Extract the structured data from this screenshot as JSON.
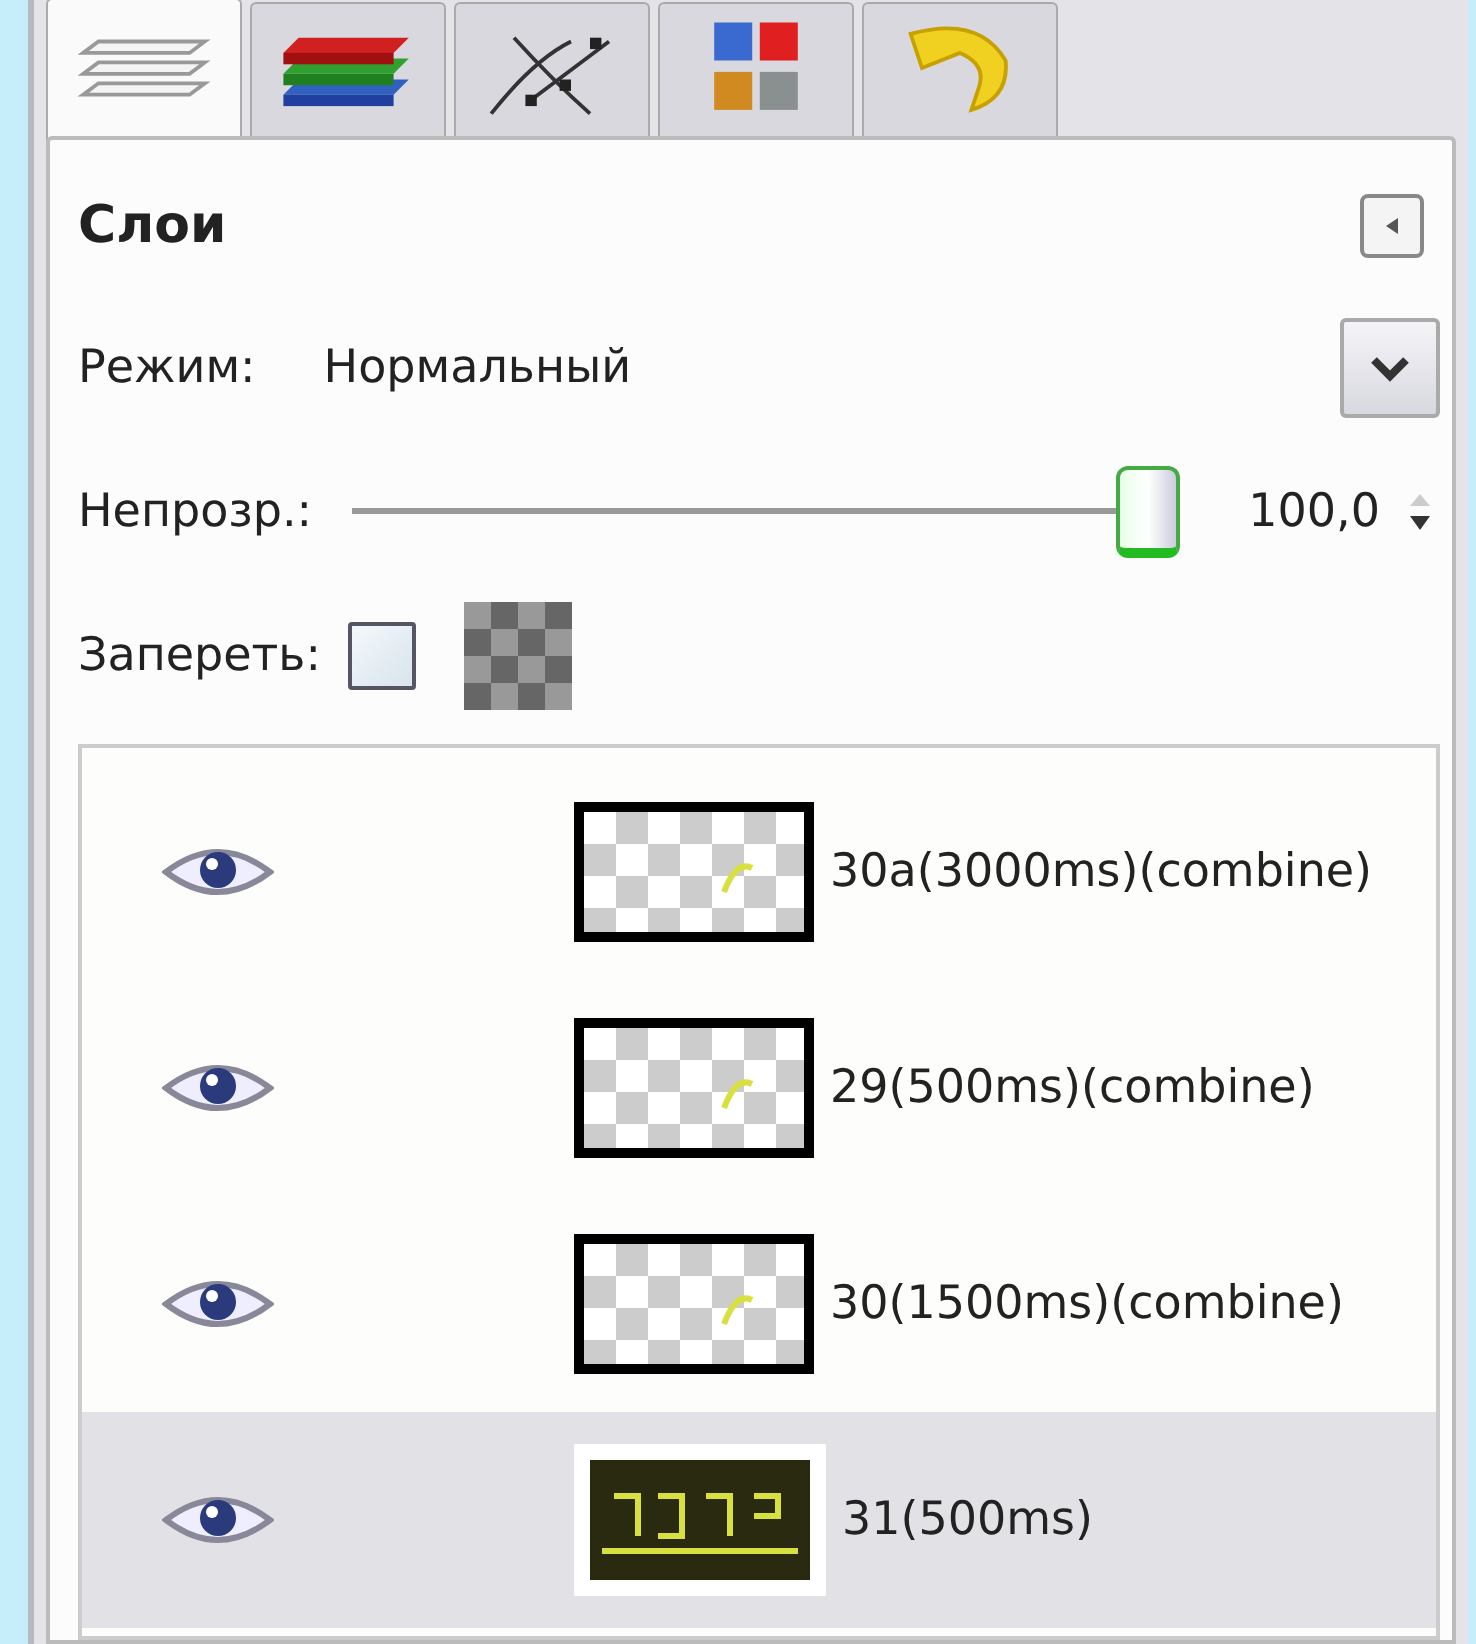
{
  "tabs": [
    {
      "kind": "layers",
      "selected": true
    },
    {
      "kind": "channels",
      "selected": false
    },
    {
      "kind": "paths",
      "selected": false
    },
    {
      "kind": "colors",
      "selected": false
    },
    {
      "kind": "undo",
      "selected": false
    }
  ],
  "title": "Слои",
  "mode": {
    "label": "Режим:",
    "value": "Нормальный"
  },
  "opacity": {
    "label": "Непрозр.:",
    "level": 1,
    "reading": "100,0"
  },
  "lock": {
    "label": "Запереть:",
    "checked": false
  },
  "layers": [
    {
      "name": "30a(3000ms)(combine)",
      "visible": true,
      "selected": false
    },
    {
      "name": "29(500ms)(combine)",
      "visible": true,
      "selected": false
    },
    {
      "name": "30(1500ms)(combine)",
      "visible": true,
      "selected": false
    },
    {
      "name": "31(500ms)",
      "visible": true,
      "selected": true
    }
  ]
}
